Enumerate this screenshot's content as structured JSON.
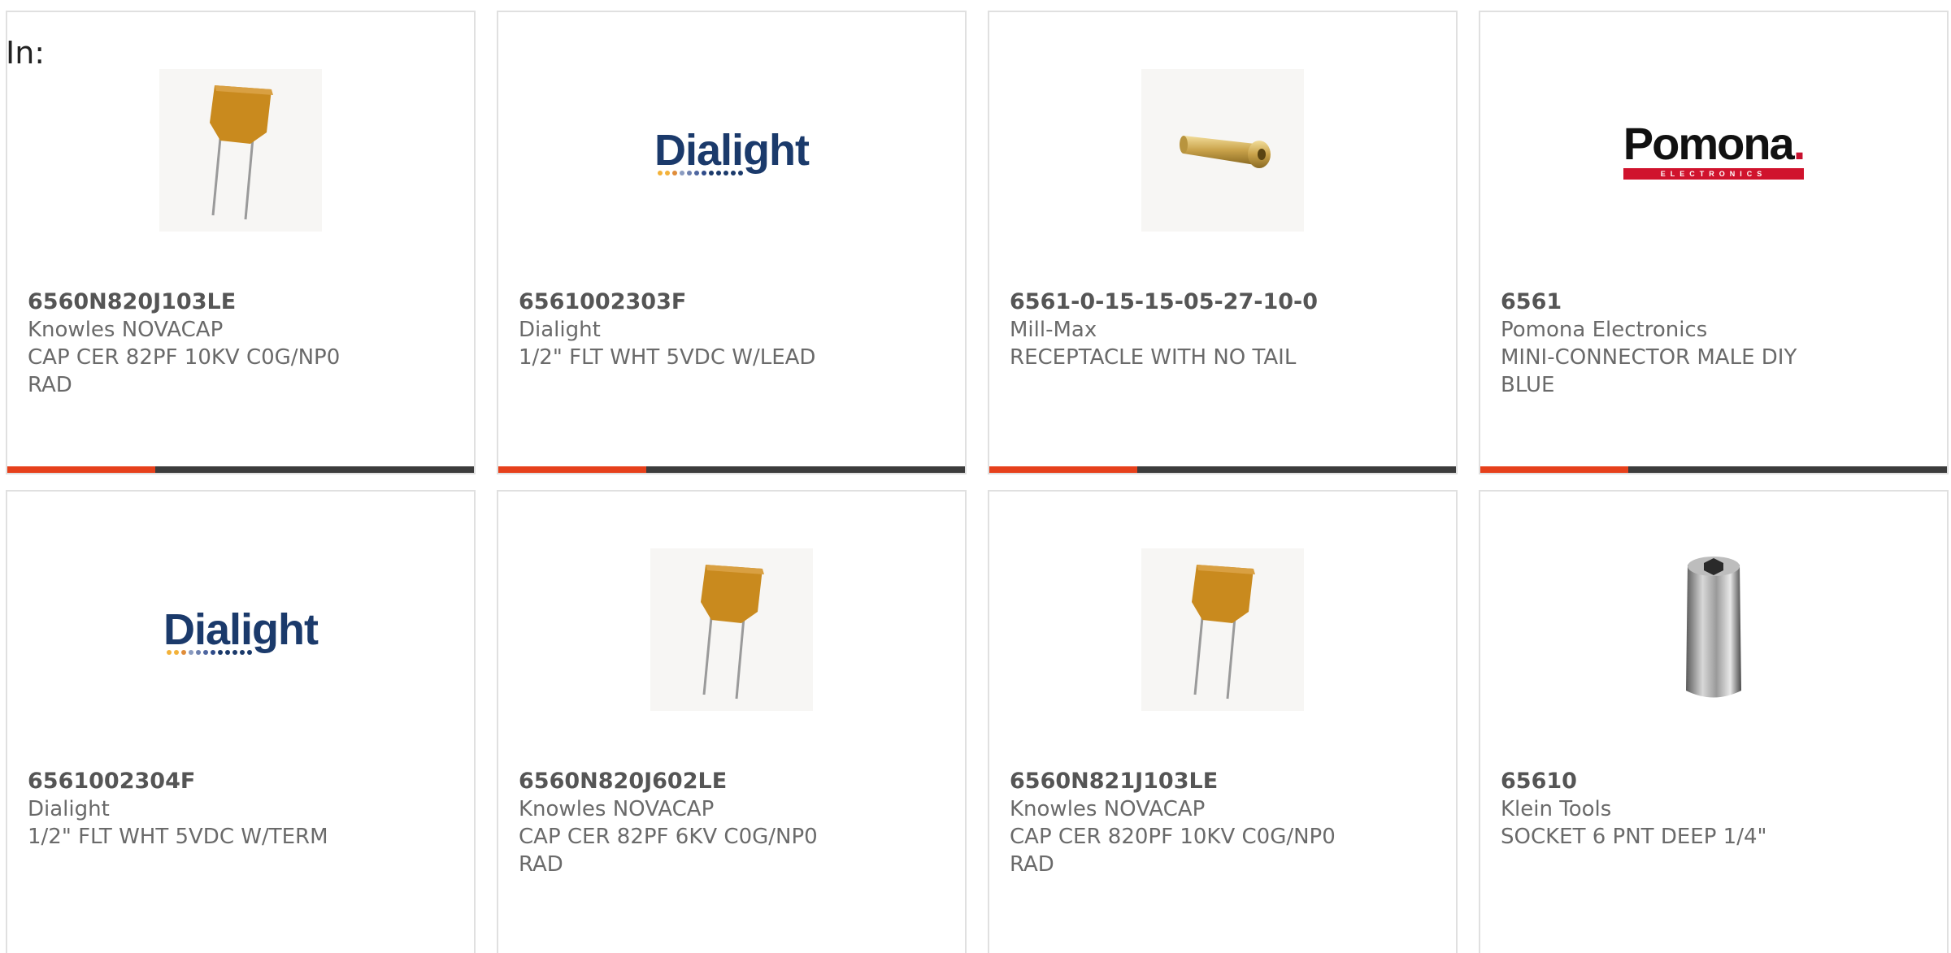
{
  "filter": {
    "label": "In:"
  },
  "products": [
    {
      "part_number": "6560N820J103LE",
      "manufacturer": "Knowles NOVACAP",
      "description": "CAP CER 82PF 10KV C0G/NP0 RAD",
      "image": "ceramic-capacitor"
    },
    {
      "part_number": "6561002303F",
      "manufacturer": "Dialight",
      "description": "1/2\" FLT WHT 5VDC W/LEAD",
      "image": "dialight-logo"
    },
    {
      "part_number": "6561-0-15-15-05-27-10-0",
      "manufacturer": "Mill-Max",
      "description": "RECEPTACLE WITH NO TAIL",
      "image": "receptacle-pin"
    },
    {
      "part_number": "6561",
      "manufacturer": "Pomona Electronics",
      "description": "MINI-CONNECTOR MALE DIY BLUE",
      "image": "pomona-logo"
    },
    {
      "part_number": "6561002304F",
      "manufacturer": "Dialight",
      "description": "1/2\" FLT WHT 5VDC W/TERM",
      "image": "dialight-logo"
    },
    {
      "part_number": "6560N820J602LE",
      "manufacturer": "Knowles NOVACAP",
      "description": "CAP CER 82PF 6KV C0G/NP0 RAD",
      "image": "ceramic-capacitor"
    },
    {
      "part_number": "6560N821J103LE",
      "manufacturer": "Knowles NOVACAP",
      "description": "CAP CER 820PF 10KV C0G/NP0 RAD",
      "image": "ceramic-capacitor"
    },
    {
      "part_number": "65610",
      "manufacturer": "Klein Tools",
      "description": "SOCKET 6 PNT DEEP 1/4\"",
      "image": "socket-tool"
    }
  ],
  "logos": {
    "dialight": "Dialight",
    "pomona": "Pomona",
    "pomona_dot": ".",
    "pomona_band": "ELECTRONICS"
  },
  "colors": {
    "accent": "#e6401b",
    "bar": "#3c3c3c",
    "capacitor": "#c98a1e",
    "dialight_blue": "#1b3a6b",
    "pomona_red": "#d0132d"
  }
}
